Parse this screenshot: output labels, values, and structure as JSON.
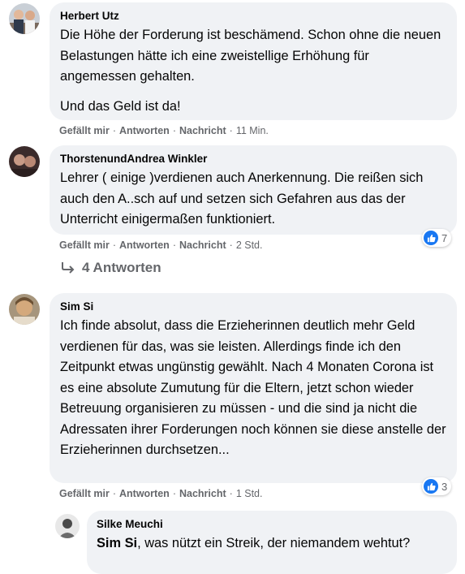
{
  "actions": {
    "like": "Gefällt mir",
    "reply": "Antworten",
    "message": "Nachricht",
    "separator": "·"
  },
  "comments": [
    {
      "author": "Herbert Utz",
      "paragraphs": [
        "Die Höhe der Forderung ist beschämend. Schon ohne die neuen Belastungen hätte ich eine zweistellige Erhöhung für angemessen gehalten.",
        "Und das Geld ist da!"
      ],
      "time": "11 Min."
    },
    {
      "author": "ThorstenundAndrea Winkler",
      "paragraphs": [
        "Lehrer ( einige )verdienen auch Anerkennung. Die reißen sich auch den A..sch auf und setzen sich Gefahren aus das der Unterricht einigermaßen funktioniert."
      ],
      "time": "2 Std.",
      "reaction_count": "7"
    },
    {
      "author": "Sim Si",
      "paragraphs": [
        "Ich finde absolut, dass die Erzieherinnen deutlich mehr Geld verdienen für das, was sie leisten. Allerdings finde ich den Zeitpunkt etwas ungünstig gewählt. Nach 4 Monaten Corona ist es eine absolute Zumutung für die Eltern, jetzt schon wieder Betreuung organisieren zu müssen - und die sind ja nicht die Adressaten ihrer Forderungen noch können sie diese anstelle der Erzieherinnen durchsetzen..."
      ],
      "time": "1 Std.",
      "reaction_count": "3"
    }
  ],
  "replies_link": "4 Antworten",
  "reply": {
    "author": "Silke Meuchi",
    "mention": "Sim Si",
    "text": ", was nützt ein Streik, der niemandem wehtut?"
  },
  "colors": {
    "bubble": "#f0f2f5",
    "muted": "#65676b",
    "like_blue": "#1877f2"
  }
}
